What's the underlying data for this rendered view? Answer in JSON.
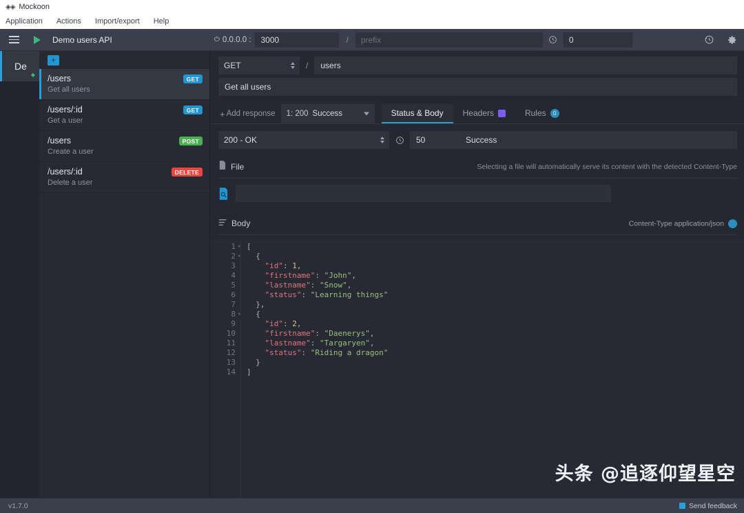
{
  "window": {
    "logo_icon": "mockoon-logo-icon",
    "title": "Mockoon"
  },
  "menubar": {
    "items": [
      {
        "label": "Application"
      },
      {
        "label": "Actions"
      },
      {
        "label": "Import/export"
      },
      {
        "label": "Help"
      }
    ]
  },
  "header": {
    "menu_icon": "hamburger-menu-icon",
    "start_icon": "play-icon",
    "environment_name": "Demo users API",
    "plug_icon": "plug-icon",
    "hostname": "0.0.0.0 :",
    "port": "3000",
    "path_separator": "/",
    "prefix_value": "",
    "prefix_placeholder": "prefix",
    "latency_icon": "clock-icon",
    "latency": "0",
    "logs_icon": "history-clock-icon",
    "settings_icon": "gear-icon"
  },
  "environments": {
    "items": [
      {
        "label": "De",
        "running": true,
        "running_icon": "running-dot-icon"
      }
    ]
  },
  "routes": {
    "add_icon": "plus-square-icon",
    "items": [
      {
        "path": "/users",
        "documentation": "Get all users",
        "method": "GET",
        "active": true
      },
      {
        "path": "/users/:id",
        "documentation": "Get a user",
        "method": "GET",
        "active": false
      },
      {
        "path": "/users",
        "documentation": "Create a user",
        "method": "POST",
        "active": false
      },
      {
        "path": "/users/:id",
        "documentation": "Delete a user",
        "method": "DELETE",
        "active": false
      }
    ]
  },
  "route_editor": {
    "method": "GET",
    "path_separator": "/",
    "endpoint": "users",
    "documentation": "Get all users",
    "add_response_label": "Add response",
    "add_response_icon": "plus-icon",
    "response_index": "1: 200",
    "response_label": "Success",
    "tabs": [
      {
        "label": "Status & Body",
        "active": true,
        "badge": null,
        "badge_type": null
      },
      {
        "label": "Headers",
        "active": false,
        "badge": "",
        "badge_type": "square"
      },
      {
        "label": "Rules",
        "active": false,
        "badge": "0",
        "badge_type": "circle"
      }
    ],
    "status_code": "200 - OK",
    "latency_icon": "clock-icon",
    "latency": "50",
    "response_name": "Success",
    "file": {
      "section_icon": "file-icon",
      "section_title": "File",
      "hint": "Selecting a file will automatically serve its content with the detected Content-Type",
      "browse_icon": "file-search-icon",
      "path_value": "",
      "path_placeholder": ""
    },
    "body": {
      "section_icon": "body-lines-icon",
      "section_title": "Body",
      "content_type_label": "Content-Type application/json",
      "content_type_badge_icon": "info-circle-icon",
      "lines": [
        {
          "n": "1",
          "fold": true,
          "tokens": [
            {
              "t": "p",
              "v": "["
            }
          ]
        },
        {
          "n": "2",
          "fold": true,
          "tokens": [
            {
              "t": "p",
              "v": "  {"
            }
          ]
        },
        {
          "n": "3",
          "fold": false,
          "tokens": [
            {
              "t": "k",
              "v": "    \"id\""
            },
            {
              "t": "p",
              "v": ": "
            },
            {
              "t": "n",
              "v": "1"
            },
            {
              "t": "p",
              "v": ","
            }
          ]
        },
        {
          "n": "4",
          "fold": false,
          "tokens": [
            {
              "t": "k",
              "v": "    \"firstname\""
            },
            {
              "t": "p",
              "v": ": "
            },
            {
              "t": "s",
              "v": "\"John\""
            },
            {
              "t": "p",
              "v": ","
            }
          ]
        },
        {
          "n": "5",
          "fold": false,
          "tokens": [
            {
              "t": "k",
              "v": "    \"lastname\""
            },
            {
              "t": "p",
              "v": ": "
            },
            {
              "t": "s",
              "v": "\"Snow\""
            },
            {
              "t": "p",
              "v": ","
            }
          ]
        },
        {
          "n": "6",
          "fold": false,
          "tokens": [
            {
              "t": "k",
              "v": "    \"status\""
            },
            {
              "t": "p",
              "v": ": "
            },
            {
              "t": "s",
              "v": "\"Learning things\""
            }
          ]
        },
        {
          "n": "7",
          "fold": false,
          "tokens": [
            {
              "t": "p",
              "v": "  },"
            }
          ]
        },
        {
          "n": "8",
          "fold": true,
          "tokens": [
            {
              "t": "p",
              "v": "  {"
            }
          ]
        },
        {
          "n": "9",
          "fold": false,
          "tokens": [
            {
              "t": "k",
              "v": "    \"id\""
            },
            {
              "t": "p",
              "v": ": "
            },
            {
              "t": "n",
              "v": "2"
            },
            {
              "t": "p",
              "v": ","
            }
          ]
        },
        {
          "n": "10",
          "fold": false,
          "tokens": [
            {
              "t": "k",
              "v": "    \"firstname\""
            },
            {
              "t": "p",
              "v": ": "
            },
            {
              "t": "s",
              "v": "\"Daenerys\""
            },
            {
              "t": "p",
              "v": ","
            }
          ]
        },
        {
          "n": "11",
          "fold": false,
          "tokens": [
            {
              "t": "k",
              "v": "    \"lastname\""
            },
            {
              "t": "p",
              "v": ": "
            },
            {
              "t": "s",
              "v": "\"Targaryen\""
            },
            {
              "t": "p",
              "v": ","
            }
          ]
        },
        {
          "n": "12",
          "fold": false,
          "tokens": [
            {
              "t": "k",
              "v": "    \"status\""
            },
            {
              "t": "p",
              "v": ": "
            },
            {
              "t": "s",
              "v": "\"Riding a dragon\""
            }
          ]
        },
        {
          "n": "13",
          "fold": false,
          "tokens": [
            {
              "t": "p",
              "v": "  }"
            }
          ]
        },
        {
          "n": "14",
          "fold": false,
          "tokens": [
            {
              "t": "p",
              "v": "]"
            }
          ]
        }
      ]
    }
  },
  "watermark": {
    "text": "头条 @追逐仰望星空"
  },
  "footer": {
    "version": "v1.7.0",
    "feedback_icon": "feedback-icon",
    "feedback_label": "Send feedback"
  },
  "colors": {
    "accent": "#2a9fd6",
    "get": "#2196d3",
    "post": "#4caf50",
    "delete": "#f4433a",
    "run": "#3cb878",
    "headers_badge": "#7b5cf0"
  }
}
